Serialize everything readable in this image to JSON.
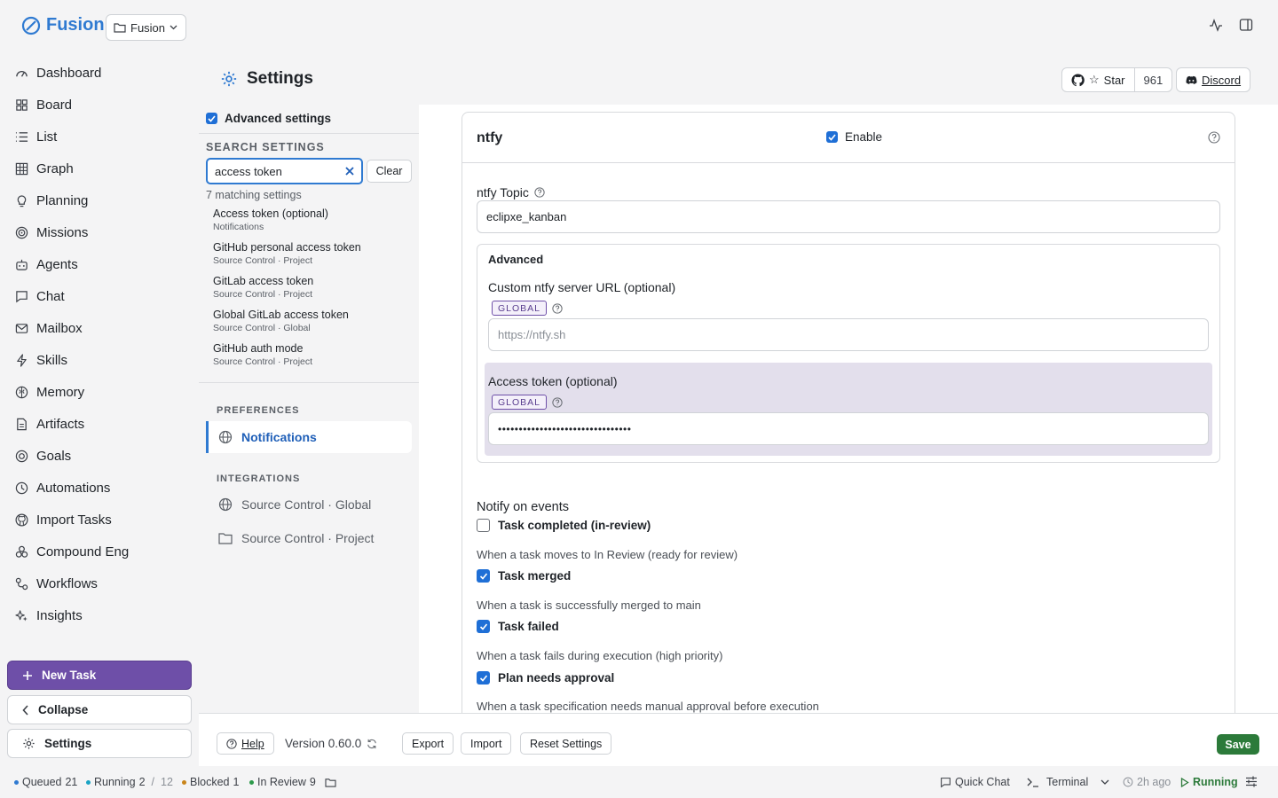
{
  "brand": {
    "name": "Fusion",
    "project": "Fusion"
  },
  "nav": {
    "items": [
      {
        "label": "Dashboard",
        "icon": "dashboard-icon"
      },
      {
        "label": "Board",
        "icon": "board-icon"
      },
      {
        "label": "List",
        "icon": "list-icon"
      },
      {
        "label": "Graph",
        "icon": "graph-icon"
      },
      {
        "label": "Planning",
        "icon": "lightbulb-icon"
      },
      {
        "label": "Missions",
        "icon": "target-icon"
      },
      {
        "label": "Agents",
        "icon": "bot-icon"
      },
      {
        "label": "Chat",
        "icon": "chat-icon"
      },
      {
        "label": "Mailbox",
        "icon": "mail-icon"
      },
      {
        "label": "Skills",
        "icon": "zap-icon"
      },
      {
        "label": "Memory",
        "icon": "brain-icon"
      },
      {
        "label": "Artifacts",
        "icon": "file-icon"
      },
      {
        "label": "Goals",
        "icon": "goal-icon"
      },
      {
        "label": "Automations",
        "icon": "clock-icon"
      },
      {
        "label": "Import Tasks",
        "icon": "github-icon"
      },
      {
        "label": "Compound Eng",
        "icon": "compound-icon"
      },
      {
        "label": "Workflows",
        "icon": "workflow-icon"
      },
      {
        "label": "Insights",
        "icon": "sparkle-icon"
      }
    ],
    "new_task": "New Task",
    "collapse": "Collapse",
    "settings": "Settings"
  },
  "header": {
    "title": "Settings",
    "github_star": "Star",
    "github_count": "961",
    "discord": "Discord"
  },
  "settings_sidebar": {
    "advanced_label": "Advanced settings",
    "search_heading": "SEARCH SETTINGS",
    "search_value": "access token",
    "clear": "Clear",
    "match_count": "7 matching settings",
    "results": [
      {
        "title": "Access token (optional)",
        "scope": "Notifications"
      },
      {
        "title": "GitHub personal access token",
        "scope": "Source Control · Project"
      },
      {
        "title": "GitLab access token",
        "scope": "Source Control · Project"
      },
      {
        "title": "Global GitLab access token",
        "scope": "Source Control · Global"
      },
      {
        "title": "GitHub auth mode",
        "scope": "Source Control · Project"
      }
    ],
    "groups": [
      {
        "heading": "PREFERENCES",
        "items": [
          "Notifications"
        ]
      },
      {
        "heading": "INTEGRATIONS",
        "items": [
          "Source Control · Global",
          "Source Control · Project"
        ]
      }
    ]
  },
  "ntfy": {
    "title": "ntfy",
    "enable": "Enable",
    "topic_label": "ntfy Topic",
    "topic_value": "eclipxe_kanban",
    "advanced": "Advanced",
    "server_label": "Custom ntfy server URL (optional)",
    "server_badge": "GLOBAL",
    "server_placeholder": "https://ntfy.sh",
    "token_label": "Access token (optional)",
    "token_badge": "GLOBAL",
    "token_value": "••••••••••••••••••••••••••••••••"
  },
  "events": {
    "title": "Notify on events",
    "items": [
      {
        "label": "Task completed (in-review)",
        "desc": "When a task moves to In Review (ready for review)",
        "checked": false
      },
      {
        "label": "Task merged",
        "desc": "When a task is successfully merged to main",
        "checked": true
      },
      {
        "label": "Task failed",
        "desc": "When a task fails during execution (high priority)",
        "checked": true
      },
      {
        "label": "Plan needs approval",
        "desc": "When a task specification needs manual approval before execution",
        "checked": true
      }
    ]
  },
  "footer": {
    "help": "Help",
    "version": "Version 0.60.0",
    "export": "Export",
    "import": "Import",
    "reset": "Reset Settings",
    "save": "Save"
  },
  "status": {
    "queued_label": "Queued",
    "queued": "21",
    "running_label": "Running",
    "running": "2",
    "running_sep": "/",
    "running_total": "12",
    "blocked_label": "Blocked",
    "blocked": "1",
    "review_label": "In Review",
    "review": "9",
    "quick_chat": "Quick Chat",
    "terminal": "Terminal",
    "ago": "2h ago",
    "state": "Running"
  },
  "colors": {
    "accent": "#2f7ad1",
    "brand_purple": "#6e4fa8",
    "save_green": "#2c7a3a",
    "running_green": "#2c7a3a"
  }
}
